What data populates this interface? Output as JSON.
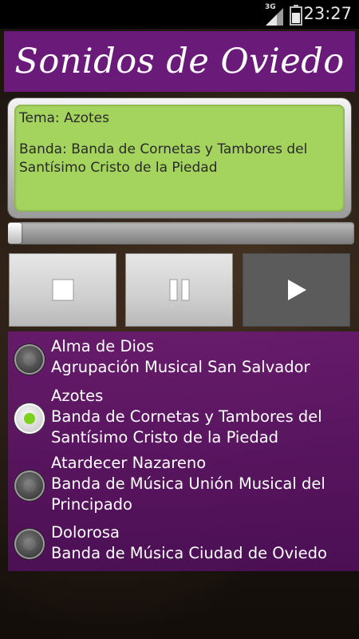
{
  "status_bar": {
    "network": "3G",
    "time": "23:27",
    "icons": [
      "signal-icon",
      "battery-icon"
    ]
  },
  "app": {
    "title": "Sonidos de Oviedo",
    "colors": {
      "header": "#6a1b7a",
      "info_panel": "#a4d35e",
      "radio_selected": "#7cd21a"
    }
  },
  "now_playing": {
    "topic": "Tema: Azotes",
    "band": "Banda: Banda de Cornetas y Tambores del Santísimo Cristo de la Piedad"
  },
  "progress": {
    "position_fraction": 0.0
  },
  "controls": {
    "stop_icon": "stop-icon",
    "pause_icon": "pause-icon",
    "play_icon": "play-icon"
  },
  "songs": [
    {
      "title": "Alma de Dios",
      "band": "Agrupación Musical San Salvador",
      "selected": false
    },
    {
      "title": "Azotes",
      "band": "Banda de Cornetas y Tambores del Santísimo Cristo de la Piedad",
      "selected": true
    },
    {
      "title": "Atardecer Nazareno",
      "band": "Banda de Música Unión Musical del Principado",
      "selected": false
    },
    {
      "title": "Dolorosa",
      "band": "Banda de Música Ciudad de Oviedo",
      "selected": false
    }
  ]
}
